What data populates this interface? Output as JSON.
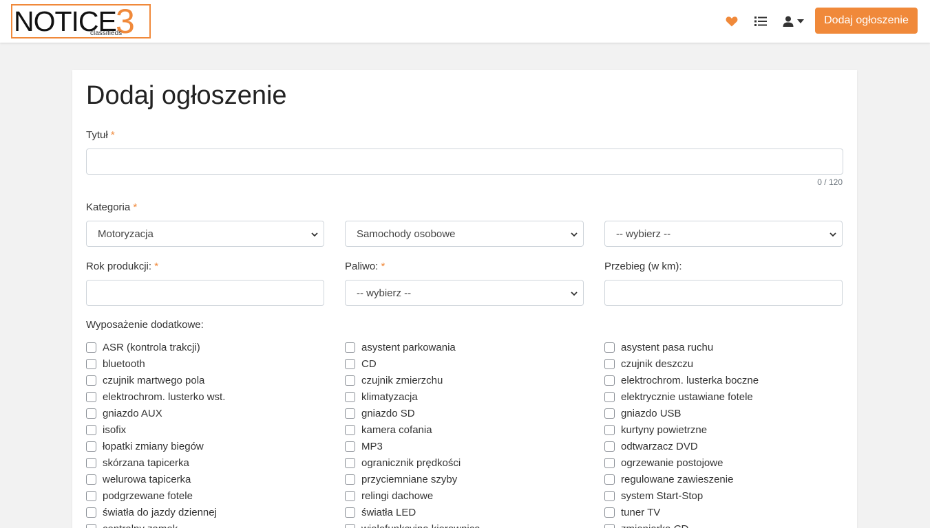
{
  "header": {
    "logo_text": "NOTICE",
    "logo_number": "3",
    "logo_sub": "classifieds",
    "add_button": "Dodaj ogłoszenie",
    "accent_color": "#f0893a",
    "icons": [
      "heart-icon",
      "list-icon",
      "user-icon",
      "caret-down-icon"
    ]
  },
  "form": {
    "title": "Dodaj ogłoszenie",
    "title_field": {
      "label": "Tytuł",
      "required": "*",
      "value": "",
      "counter": "0 / 120"
    },
    "category": {
      "label": "Kategoria",
      "required": "*",
      "selects": [
        "Motoryzacja",
        "Samochody osobowe",
        "-- wybierz --"
      ]
    },
    "year": {
      "label": "Rok produkcji:",
      "required": "*",
      "value": ""
    },
    "fuel": {
      "label": "Paliwo:",
      "required": "*",
      "value": "-- wybierz --"
    },
    "mileage": {
      "label": "Przebieg (w km):",
      "value": ""
    },
    "equipment": {
      "label": "Wyposażenie dodatkowe:",
      "col1": [
        "ASR (kontrola trakcji)",
        "bluetooth",
        "czujnik martwego pola",
        "elektrochrom. lusterko wst.",
        "gniazdo AUX",
        "isofix",
        "łopatki zmiany biegów",
        "skórzana tapicerka",
        "welurowa tapicerka",
        "podgrzewane fotele",
        "światła do jazdy dziennej",
        "centralny zamek"
      ],
      "col2": [
        "asystent parkowania",
        "CD",
        "czujnik zmierzchu",
        "klimatyzacja",
        "gniazdo SD",
        "kamera cofania",
        "MP3",
        "ogranicznik prędkości",
        "przyciemniane szyby",
        "relingi dachowe",
        "światła LED",
        "wielofunkcyjna kierownica"
      ],
      "col3": [
        "asystent pasa ruchu",
        "czujnik deszczu",
        "elektrochrom. lusterka boczne",
        "elektrycznie ustawiane fotele",
        "gniazdo USB",
        "kurtyny powietrzne",
        "odtwarzacz DVD",
        "ogrzewanie postojowe",
        "regulowane zawieszenie",
        "system Start-Stop",
        "tuner TV",
        "zmieniarka CD"
      ]
    }
  }
}
